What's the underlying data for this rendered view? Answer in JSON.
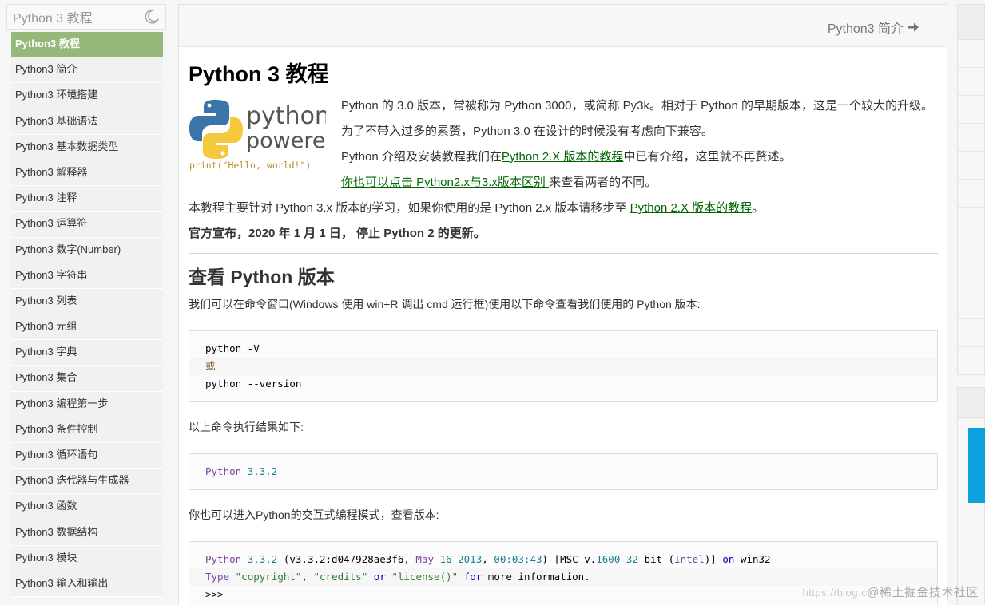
{
  "sidebar": {
    "title": "Python 3 教程",
    "items": [
      {
        "label": "Python3 教程",
        "active": true
      },
      {
        "label": "Python3 简介"
      },
      {
        "label": "Python3 环境搭建"
      },
      {
        "label": "Python3 基础语法"
      },
      {
        "label": "Python3 基本数据类型"
      },
      {
        "label": "Python3 解释器"
      },
      {
        "label": "Python3 注释"
      },
      {
        "label": "Python3 运算符"
      },
      {
        "label": "Python3 数字(Number)"
      },
      {
        "label": "Python3 字符串"
      },
      {
        "label": "Python3 列表"
      },
      {
        "label": "Python3 元组"
      },
      {
        "label": "Python3 字典"
      },
      {
        "label": "Python3 集合"
      },
      {
        "label": "Python3 编程第一步"
      },
      {
        "label": "Python3 条件控制"
      },
      {
        "label": "Python3 循环语句"
      },
      {
        "label": "Python3 迭代器与生成器"
      },
      {
        "label": "Python3 函数"
      },
      {
        "label": "Python3 数据结构"
      },
      {
        "label": "Python3 模块"
      },
      {
        "label": "Python3 输入和输出"
      }
    ]
  },
  "topnav": {
    "next_label": "Python3 简介"
  },
  "main": {
    "title": "Python 3 教程",
    "logo": {
      "word1": "python",
      "word2": "powered",
      "code": "print(\"Hello, world!\")"
    },
    "intro1": "Python 的 3.0 版本，常被称为 Python 3000，或简称 Py3k。相对于 Python 的早期版本，这是一个较大的升级。为了不带入过多的累赘，Python 3.0 在设计的时候没有考虑向下兼容。",
    "intro2_prefix": "Python 介绍及安装教程我们在",
    "intro2_link": "Python 2.X 版本的教程",
    "intro2_suffix": "中已有介绍，这里就不再赘述。",
    "intro3_link": "你也可以点击 Python2.x与3.x版本区别 ",
    "intro3_suffix": "来查看两者的不同。",
    "para1_prefix": "本教程主要针对 Python 3.x 版本的学习，如果你使用的是 Python 2.x 版本请移步至 ",
    "para1_link": "Python 2.X 版本的教程",
    "para1_suffix": "。",
    "notice": "官方宣布，2020 年 1 月 1 日， 停止 Python 2 的更新。",
    "h2": "查看 Python 版本",
    "desc1": "我们可以在命令窗口(Windows 使用 win+R 调出 cmd 运行框)使用以下命令查看我们使用的 Python 版本:",
    "code1": {
      "line1": "python -V",
      "line2": "或",
      "line3": "python --version"
    },
    "desc2": "以上命令执行结果如下:",
    "code2": {
      "line1_a": "Python",
      "line1_b": "3.3.2"
    },
    "desc3": "你也可以进入Python的交互式编程模式，查看版本:",
    "code3": {
      "l1": [
        "Python",
        " ",
        "3.3.2",
        " (v3.3.2:d047928ae3f6, ",
        "May",
        " ",
        "16",
        " ",
        "2013",
        ", ",
        "00:03:43",
        ") [MSC v.",
        "1600",
        " ",
        "32",
        " bit (",
        "Intel",
        ")] ",
        "on",
        " win32"
      ],
      "l2": [
        "Type",
        " ",
        "\"copyright\"",
        ", ",
        "\"credits\"",
        " ",
        "or",
        " ",
        "\"license()\"",
        " ",
        "for",
        " more information."
      ],
      "l3": ">>>"
    }
  },
  "watermark": {
    "url": "https://blog.c",
    "text": "@稀土掘金技术社区"
  }
}
